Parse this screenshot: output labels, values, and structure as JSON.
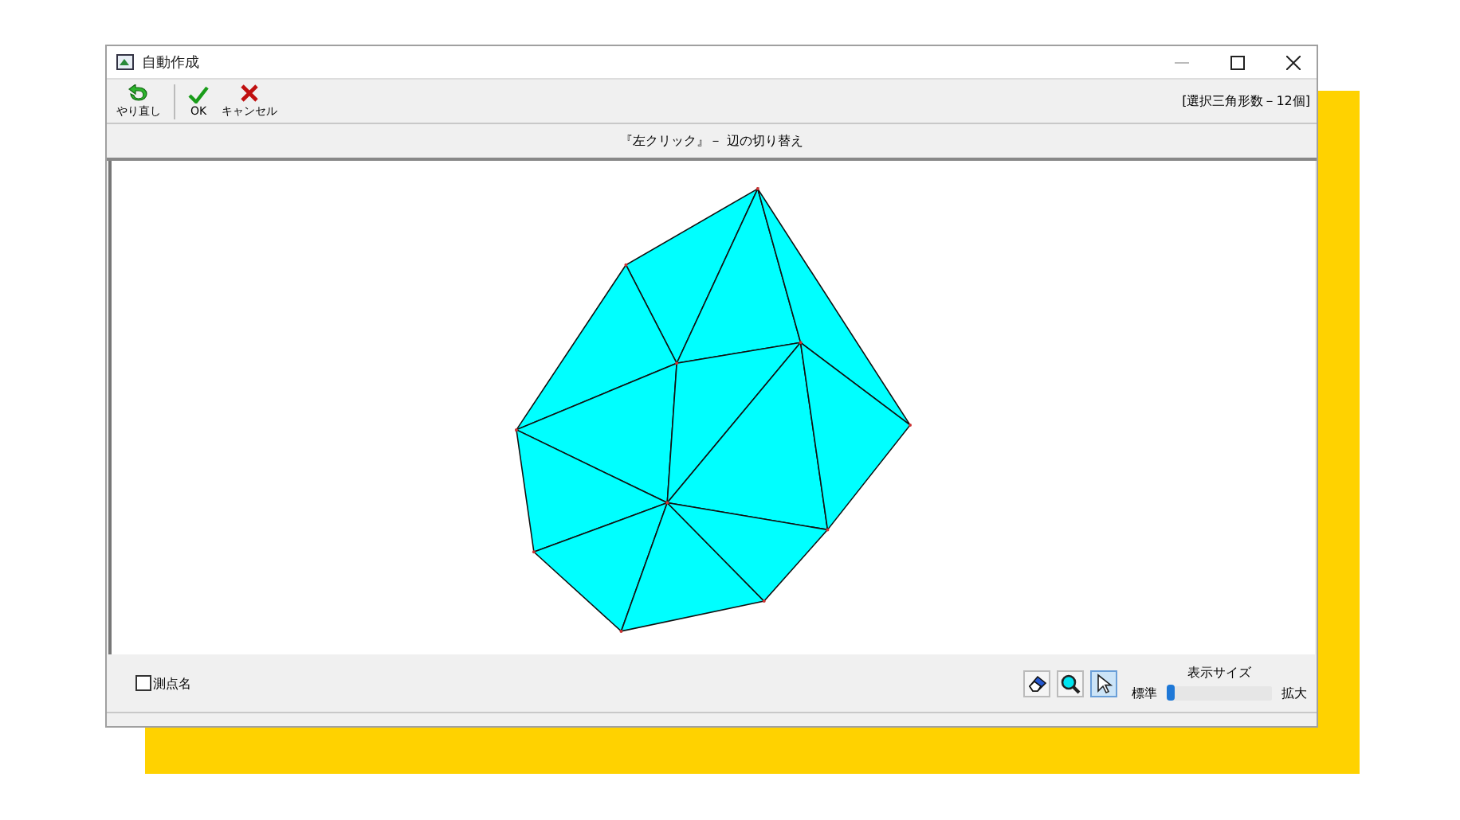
{
  "window": {
    "title": "自動作成"
  },
  "toolbar": {
    "buttons": [
      {
        "kind": "redo",
        "label": "やり直し"
      },
      {
        "kind": "ok",
        "label": "OK"
      },
      {
        "kind": "cancel",
        "label": "キャンセル"
      }
    ],
    "count": "[選択三角形数－12個]"
  },
  "hint": "『左クリック』－ 辺の切り替え",
  "options": {
    "point_names": {
      "label": "測点名",
      "checked": false
    }
  },
  "tools": [
    {
      "kind": "eraser",
      "selected": false
    },
    {
      "kind": "zoom",
      "selected": false
    },
    {
      "kind": "pointer",
      "selected": true
    }
  ],
  "display_size": {
    "title": "表示サイズ",
    "min_label": "標準",
    "max_label": "拡大",
    "level": 0
  }
}
